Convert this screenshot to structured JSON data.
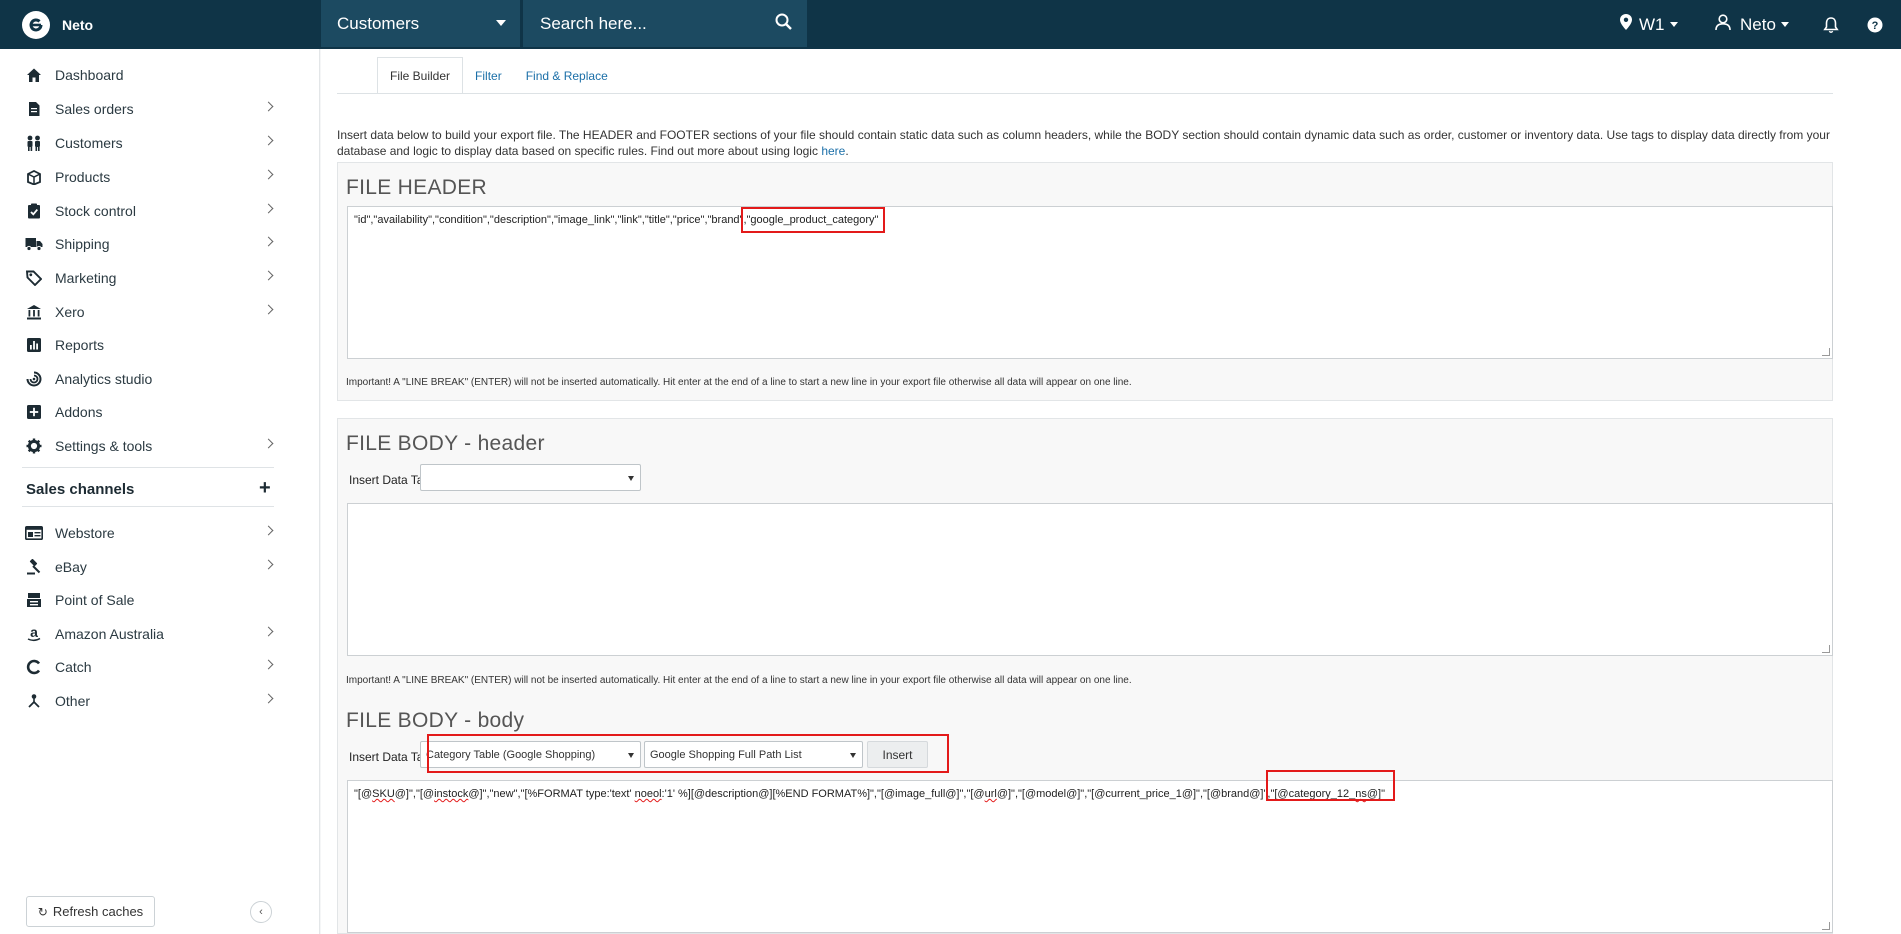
{
  "app": {
    "name": "Neto"
  },
  "topbar": {
    "section": "Customers",
    "search_placeholder": "Search here...",
    "location": "W1",
    "user": "Neto"
  },
  "sidebar": {
    "items": [
      {
        "label": "Dashboard",
        "icon": "home-icon",
        "has_arrow": false
      },
      {
        "label": "Sales orders",
        "icon": "document-icon",
        "has_arrow": true
      },
      {
        "label": "Customers",
        "icon": "people-icon",
        "has_arrow": true
      },
      {
        "label": "Products",
        "icon": "box-icon",
        "has_arrow": true
      },
      {
        "label": "Stock control",
        "icon": "clipboard-check-icon",
        "has_arrow": true
      },
      {
        "label": "Shipping",
        "icon": "truck-icon",
        "has_arrow": true
      },
      {
        "label": "Marketing",
        "icon": "tag-icon",
        "has_arrow": true
      },
      {
        "label": "Xero",
        "icon": "bank-icon",
        "has_arrow": true
      },
      {
        "label": "Reports",
        "icon": "bar-chart-icon",
        "has_arrow": false
      },
      {
        "label": "Analytics studio",
        "icon": "analytics-icon",
        "has_arrow": false
      },
      {
        "label": "Addons",
        "icon": "plus-square-icon",
        "has_arrow": false
      },
      {
        "label": "Settings & tools",
        "icon": "gear-icon",
        "has_arrow": true
      }
    ],
    "channels_heading": "Sales channels",
    "channels": [
      {
        "label": "Webstore",
        "icon": "browser-icon",
        "has_arrow": true
      },
      {
        "label": "eBay",
        "icon": "gavel-icon",
        "has_arrow": true
      },
      {
        "label": "Point of Sale",
        "icon": "pos-icon",
        "has_arrow": false
      },
      {
        "label": "Amazon Australia",
        "icon": "amazon-icon",
        "has_arrow": true
      },
      {
        "label": "Catch",
        "icon": "catch-icon",
        "has_arrow": true
      },
      {
        "label": "Other",
        "icon": "network-icon",
        "has_arrow": true
      }
    ],
    "refresh_label": "Refresh caches"
  },
  "tabs": [
    "File Builder",
    "Filter",
    "Find & Replace"
  ],
  "intro": {
    "text": "Insert data below to build your export file. The HEADER and FOOTER sections of your file should contain static data such as column headers, while the BODY section should contain dynamic data such as order, customer or inventory data. Use tags to display data directly from your database and logic to display data based on specific rules. Find out more about using logic ",
    "link": "here",
    "end": "."
  },
  "file_header": {
    "title": "FILE HEADER",
    "value_a": "\"id\",\"availability\",\"condition\",\"description\",\"image_link\",\"link\",\"title\",\"price\",\"brand\"",
    "value_b": ",\"google_product_category\"",
    "note": "Important! A \"LINE BREAK\" (ENTER) will not be inserted automatically. Hit enter at the end of a line to start a new line in your export file otherwise all data will appear on one line."
  },
  "body_header": {
    "title": "FILE BODY - header",
    "tag_label": "Insert Data Tag:",
    "tag_value": "",
    "note": "Important! A \"LINE BREAK\" (ENTER) will not be inserted automatically. Hit enter at the end of a line to start a new line in your export file otherwise all data will appear on one line."
  },
  "body_body": {
    "title": "FILE BODY - body",
    "tag_label": "Insert Data Tag:",
    "select1": "Category Table (Google Shopping)",
    "select2": "Google Shopping Full Path List",
    "insert_label": "Insert",
    "v1": "\"[@",
    "v2": "SKU",
    "v3": "@]\",\"[@",
    "v4": "instock",
    "v5": "@]\",\"new\",\"[%FORMAT type:'text' ",
    "v6": "noeol",
    "v7": ":'1' %][@description@][%END FORMAT%]\",\"[@image_full@]\",\"[@",
    "v8": "url",
    "v9": "@]\",\"[@model@]\",\"[@current_price_1@]\",\"[@brand@]\"",
    "v10": ",\"[@category_12_",
    "v11": "ns",
    "v12": "@]\""
  },
  "colors": {
    "topbar": "#0f3447",
    "accent": "#1b6fa8",
    "highlight": "#e31a1a"
  }
}
